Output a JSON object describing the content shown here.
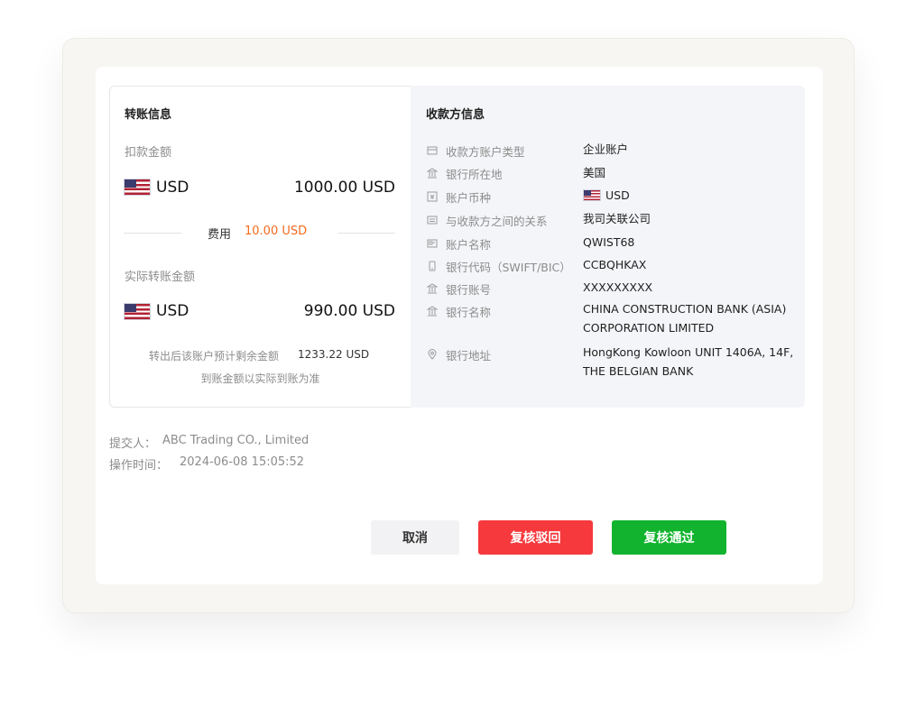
{
  "transfer": {
    "title": "转账信息",
    "debit_label": "扣款金额",
    "debit_currency": "USD",
    "debit_amount": "1000.00 USD",
    "fee_label": "费用",
    "fee_value": "10.00 USD",
    "actual_label": "实际转账金额",
    "actual_currency": "USD",
    "actual_amount": "990.00 USD",
    "balance_label": "转出后该账户预计剩余金额",
    "balance_value": "1233.22 USD",
    "arrival_note": "到账金额以实际到账为准"
  },
  "payee": {
    "title": "收款方信息",
    "rows": [
      {
        "icon": "card-icon",
        "label": "收款方账户类型",
        "value": "企业账户"
      },
      {
        "icon": "bank-icon",
        "label": "银行所在地",
        "value": "美国"
      },
      {
        "icon": "currency-icon",
        "label": "账户币种",
        "value": "USD"
      },
      {
        "icon": "list-icon",
        "label": "与收款方之间的关系",
        "value": "我司关联公司"
      },
      {
        "icon": "id-card-icon",
        "label": "账户名称",
        "value": "QWIST68"
      },
      {
        "icon": "phone-icon",
        "label": "银行代码（SWIFT/BIC）",
        "value": "CCBQHKAX"
      },
      {
        "icon": "bank-icon",
        "label": "银行账号",
        "value": "XXXXXXXXX"
      },
      {
        "icon": "bank-icon",
        "label": "银行名称",
        "value_line1": "CHINA CONSTRUCTION BANK (ASIA)",
        "value_line2": "CORPORATION LIMITED"
      },
      {
        "icon": "location-icon",
        "label": "银行地址",
        "value_line1": "HongKong Kowloon UNIT 1406A, 14F,",
        "value_line2": "THE BELGIAN BANK"
      }
    ]
  },
  "meta": {
    "submitter_label": "提交人：",
    "submitter_value": "ABC Trading CO., Limited",
    "time_label": "操作时间：",
    "time_value": "2024-06-08 15:05:52"
  },
  "actions": {
    "cancel": "取消",
    "reject": "复核驳回",
    "approve": "复核通过"
  },
  "colors": {
    "fee": "#f26b1d",
    "reject": "#f5393d",
    "approve": "#12b32e"
  }
}
